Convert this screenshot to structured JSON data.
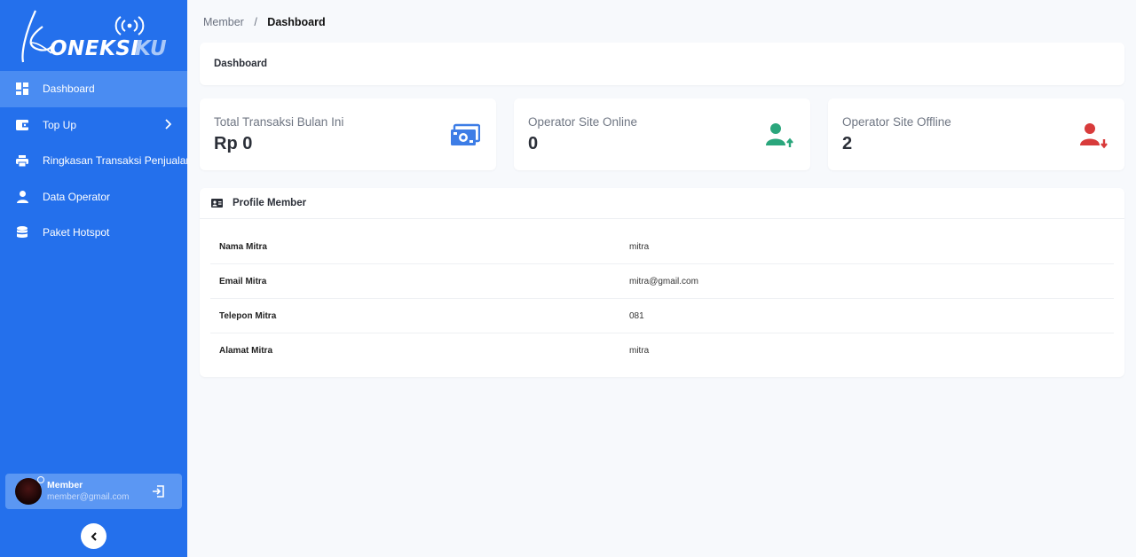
{
  "brand": {
    "logo_text": "KONEKSIKU"
  },
  "colors": {
    "sidebar": "#2470ec",
    "active_item": "#4a8cf2",
    "online": "#2aa67c",
    "offline": "#d83b3b",
    "money": "#3d7de6"
  },
  "sidebar": {
    "items": [
      {
        "label": "Dashboard",
        "icon": "dashboard-icon",
        "active": true
      },
      {
        "label": "Top Up",
        "icon": "wallet-icon",
        "has_submenu": true
      },
      {
        "label": "Ringkasan Transaksi Penjualan",
        "icon": "printer-icon"
      },
      {
        "label": "Data Operator",
        "icon": "user-icon"
      },
      {
        "label": "Paket Hotspot",
        "icon": "database-icon"
      }
    ],
    "user": {
      "name": "Member",
      "email": "member@gmail.com"
    }
  },
  "breadcrumb": {
    "parent": "Member",
    "separator": "/",
    "current": "Dashboard"
  },
  "page_header": {
    "title": "Dashboard"
  },
  "stats": [
    {
      "label": "Total Transaksi Bulan Ini",
      "value": "Rp 0",
      "icon": "money-icon"
    },
    {
      "label": "Operator Site Online",
      "value": "0",
      "icon": "user-online-icon"
    },
    {
      "label": "Operator Site Offline",
      "value": "2",
      "icon": "user-offline-icon"
    }
  ],
  "profile": {
    "title": "Profile Member",
    "rows": [
      {
        "key": "Nama Mitra",
        "value": "mitra"
      },
      {
        "key": "Email Mitra",
        "value": "mitra@gmail.com"
      },
      {
        "key": "Telepon Mitra",
        "value": "081"
      },
      {
        "key": "Alamat Mitra",
        "value": "mitra"
      }
    ]
  }
}
